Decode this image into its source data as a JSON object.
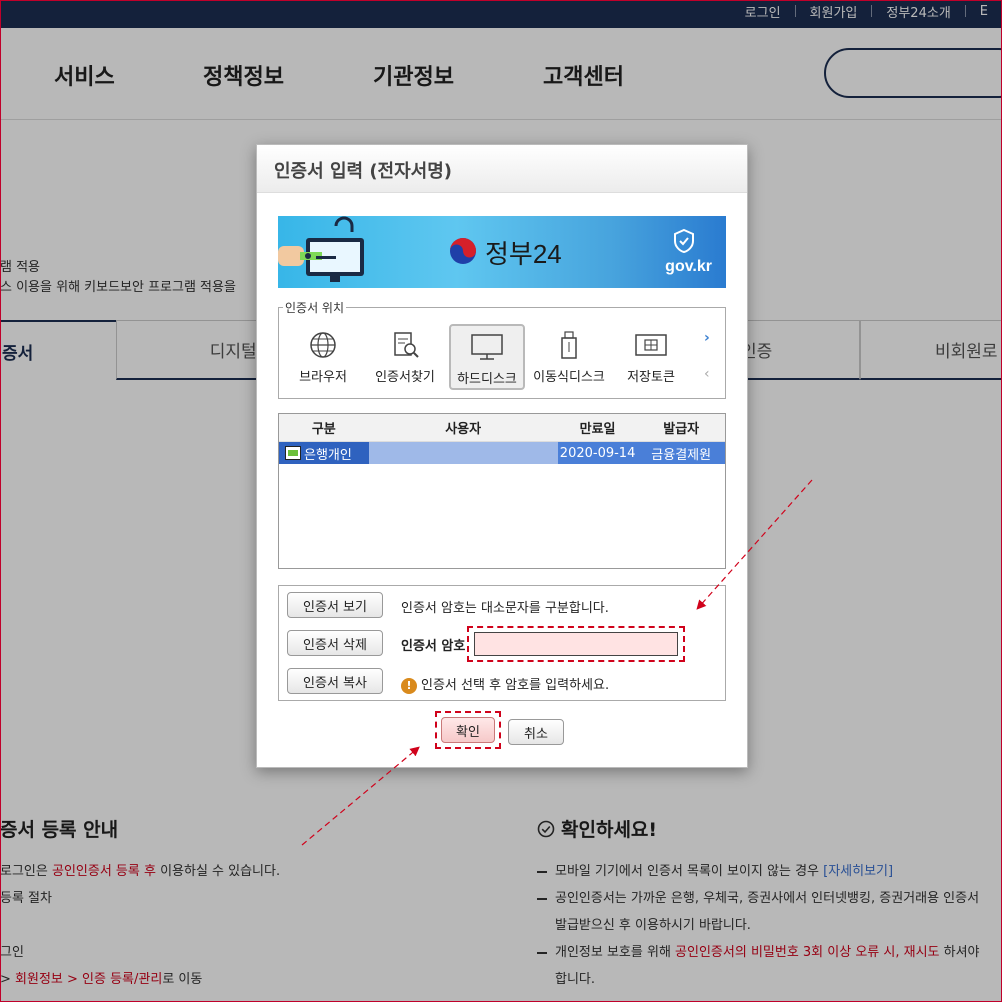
{
  "topbar": {
    "links": [
      "로그인",
      "회원가입",
      "정부24소개",
      "E"
    ]
  },
  "gnb": {
    "items": [
      "서비스",
      "정책정보",
      "기관정보",
      "고객센터"
    ]
  },
  "page": {
    "info_line1": "램 적용",
    "info_line2": "스 이용을 위해 키보드보안 프로그램 적용을",
    "tabs": [
      "증서",
      "디지털원",
      "인증",
      "비회원로"
    ]
  },
  "section_left": {
    "title": "증서 등록 안내",
    "line1_a": "로그인은 ",
    "line1_red": "공인인증서 등록 후",
    "line1_b": " 이용하실 수 있습니다.",
    "line2": "등록 절차",
    "line3": "그인",
    "line4_a": "> ",
    "line4_red": "회원정보 > 인증 등록/관리",
    "line4_b": "로 이동"
  },
  "section_right": {
    "title": "확인하세요!",
    "item1_a": "모바일 기기에서 인증서 목록이 보이지 않는 경우 ",
    "item1_link": "[자세히보기]",
    "item2_line1": "공인인증서는 가까운 은행, 우체국, 증권사에서 인터넷뱅킹, 증권거래용 인증서",
    "item2_line2": "발급받으신 후 이용하시기 바랍니다.",
    "item3_a": "개인정보 보호를 위해 ",
    "item3_red": "공인인증서의 비밀번호 3회 이상 오류 시, 재시도",
    "item3_b": " 하셔야",
    "item3_line2": "합니다."
  },
  "dialog": {
    "title": "인증서 입력 (전자서명)",
    "banner_logo": "정부24",
    "banner_domain": "gov.kr",
    "location_legend": "인증서 위치",
    "locations": [
      "브라우저",
      "인증서찾기",
      "하드디스크",
      "이동식디스크",
      "저장토큰"
    ],
    "table": {
      "headers": [
        "구분",
        "사용자",
        "만료일",
        "발급자"
      ],
      "rows": [
        {
          "type": "은행개인",
          "user": "",
          "expiry": "2020-09-14",
          "issuer": "금융결제원"
        }
      ]
    },
    "buttons": {
      "view": "인증서 보기",
      "delete": "인증서 삭제",
      "copy": "인증서 복사",
      "ok": "확인",
      "cancel": "취소"
    },
    "case_note": "인증서 암호는 대소문자를 구분합니다.",
    "password_label": "인증서 암호",
    "password_value": "",
    "warning_note": "인증서 선택 후 암호를 입력하세요."
  },
  "colors": {
    "topbar": "#1c2f53",
    "highlight": "#d0021b",
    "selected_row": "#4a7fd8"
  }
}
